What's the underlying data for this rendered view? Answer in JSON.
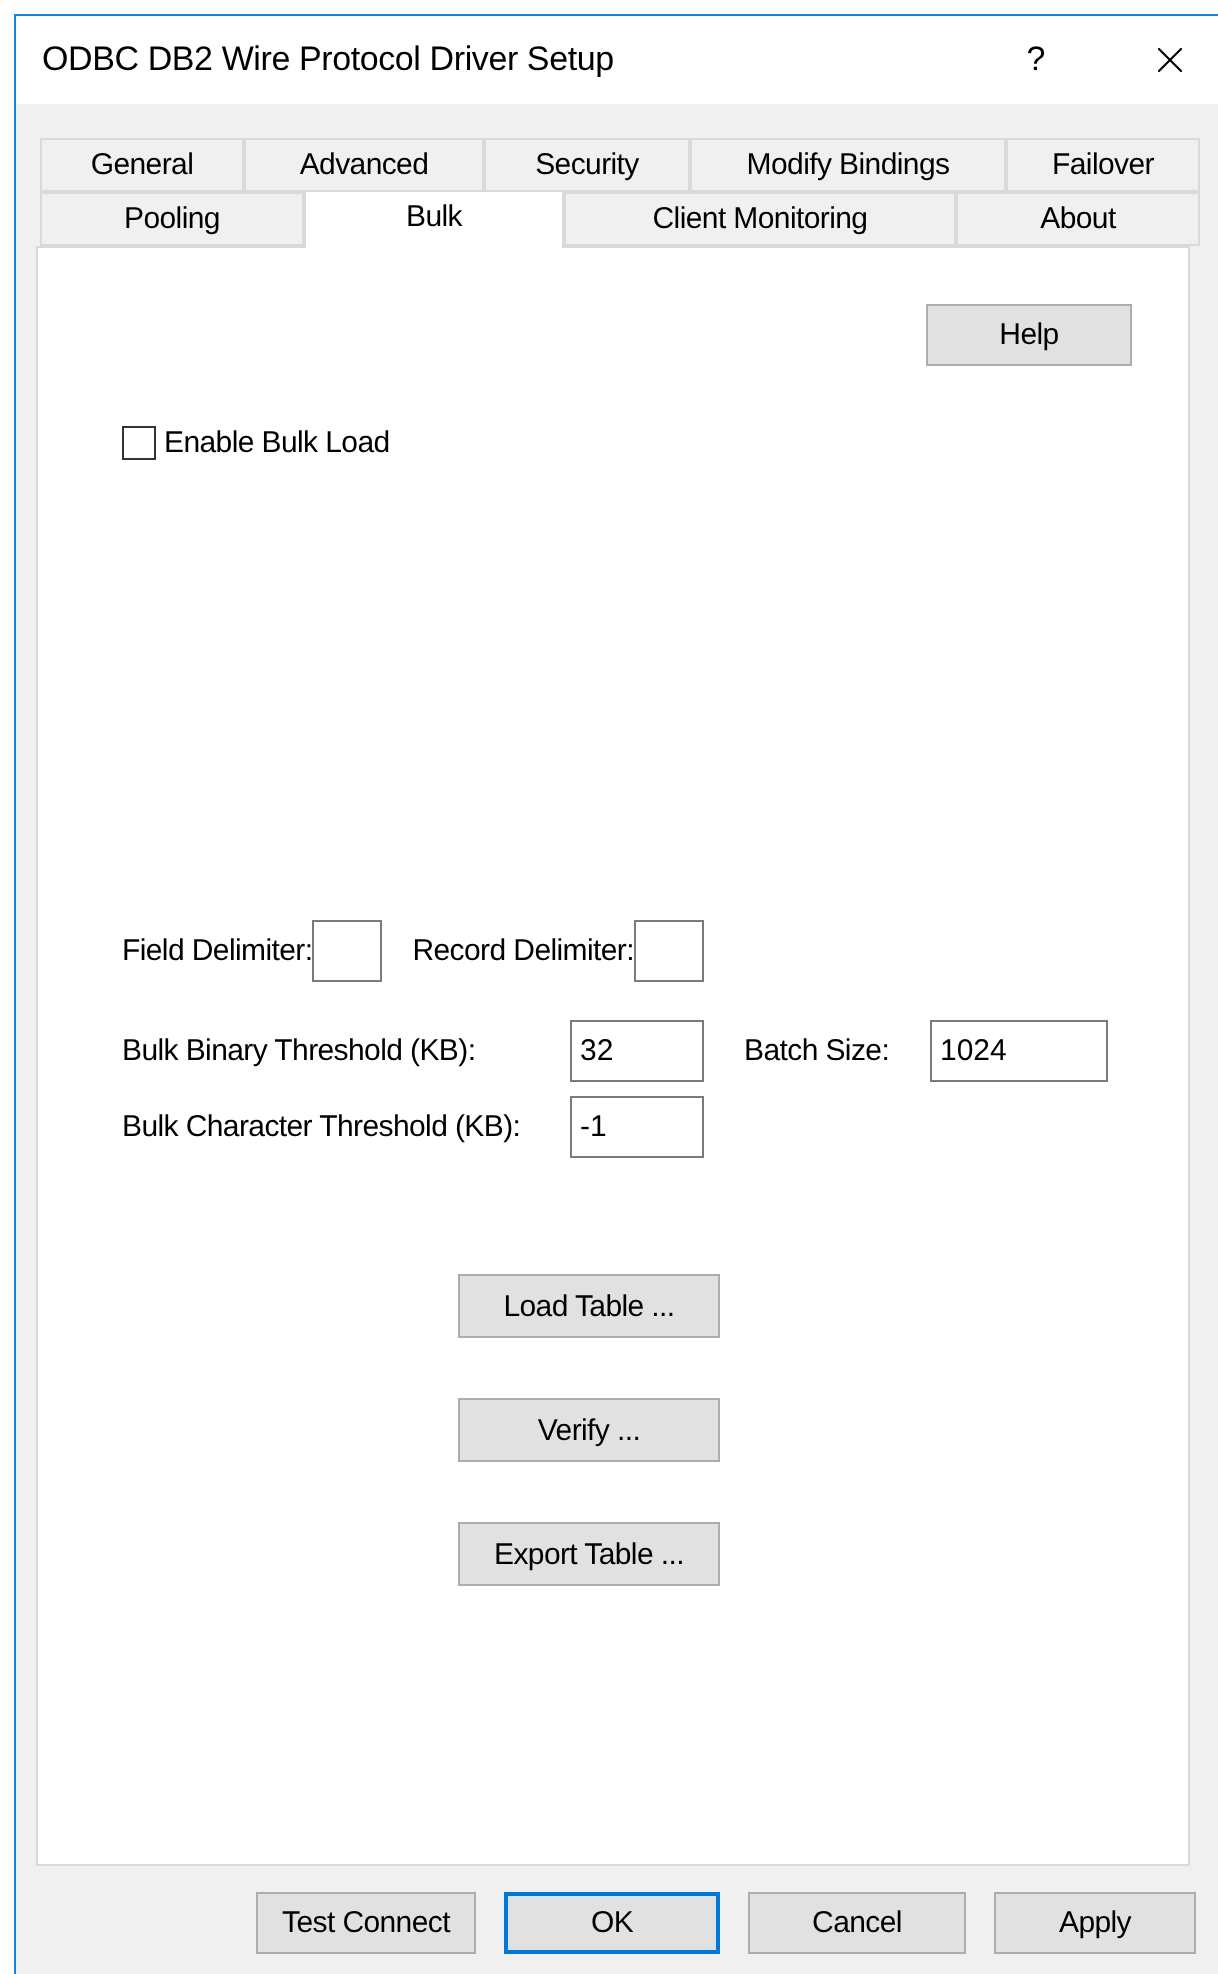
{
  "window": {
    "title": "ODBC DB2 Wire Protocol Driver Setup",
    "help_glyph": "?"
  },
  "tab_rows": [
    [
      {
        "label": "General",
        "selected": false
      },
      {
        "label": "Advanced",
        "selected": false
      },
      {
        "label": "Security",
        "selected": false
      },
      {
        "label": "Modify Bindings",
        "selected": false
      },
      {
        "label": "Failover",
        "selected": false
      }
    ],
    [
      {
        "label": "Pooling",
        "selected": false
      },
      {
        "label": "Bulk",
        "selected": true
      },
      {
        "label": "Client Monitoring",
        "selected": false
      },
      {
        "label": "About",
        "selected": false
      }
    ]
  ],
  "help_button": "Help",
  "enable_bulk_load": {
    "label": "Enable Bulk Load",
    "checked": false
  },
  "delimiters": [
    {
      "label": "Field Delimiter:"
    },
    {
      "label": "Record Delimiter:"
    }
  ],
  "thresholds": [
    {
      "label": "Bulk Binary Threshold (KB):",
      "value": "32",
      "extra": {
        "label": "Batch Size:",
        "value": "1024"
      }
    },
    {
      "label": "Bulk Character Threshold (KB):",
      "value": "-1"
    }
  ],
  "actions": [
    "Load Table ...",
    "Verify ...",
    "Export Table ..."
  ],
  "footer_buttons": [
    {
      "label": "Test Connect",
      "default": false
    },
    {
      "label": "OK",
      "default": true
    },
    {
      "label": "Cancel",
      "default": false
    },
    {
      "label": "Apply",
      "default": false
    }
  ]
}
